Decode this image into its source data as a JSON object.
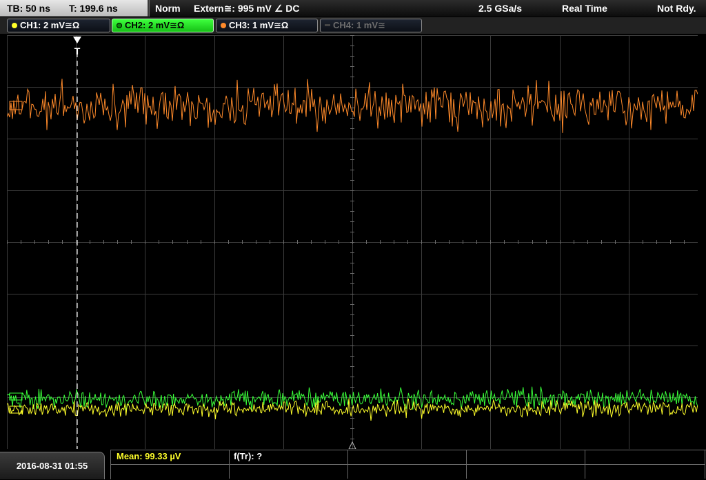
{
  "header": {
    "timebase": "TB: 50 ns",
    "trigger_time": "T: 199.6 ns",
    "mode": "Norm",
    "trigger_source": "Extern≅: 995 mV ∠ DC",
    "sample_rate": "2.5 GSa/s",
    "acquisition": "Real Time",
    "status": "Not Rdy."
  },
  "channels": [
    {
      "label": "CH1: 2 mV≅Ω",
      "color": "#ffff2a",
      "state": "on"
    },
    {
      "label": "CH2: 2 mV≅Ω",
      "color": "#39ff39",
      "state": "active"
    },
    {
      "label": "CH3: 1 mV≅Ω",
      "color": "#ff8a2a",
      "state": "on"
    },
    {
      "label": "CH4: 1 mV≅",
      "color": "#5a5a5a",
      "state": "off"
    }
  ],
  "trigger_marker": "T",
  "footer": {
    "datetime": "2016-08-31 01:55",
    "measurements": [
      {
        "label": "Mean: 99.33 µV",
        "color": "#ffff2a"
      },
      {
        "label": "f(Tr): ?",
        "color": "#ffffff"
      }
    ]
  },
  "colors": {
    "ch1": "#ffff2a",
    "ch2": "#39ff39",
    "ch3": "#ff8a2a",
    "grid": "#3c3c3c",
    "background": "#000000"
  },
  "icons": [
    "trigger-position-icon",
    "channel-marker-icon",
    "trigger-level-icon"
  ]
}
